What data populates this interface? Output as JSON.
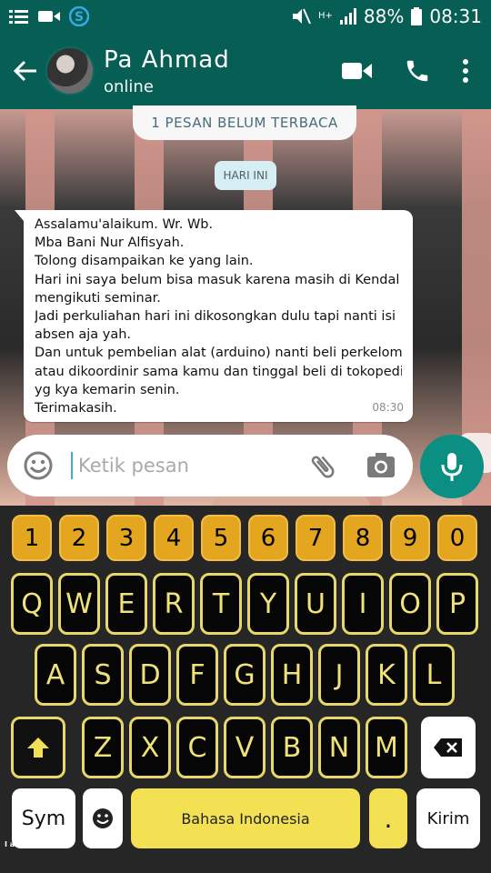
{
  "status_bar": {
    "battery_percent": "88%",
    "time": "08:31",
    "network": "H+",
    "icons": [
      "list-icon",
      "video-icon",
      "skype-icon",
      "mute-icon",
      "signal-icon",
      "battery-icon"
    ]
  },
  "header": {
    "contact_name": "Pa Ahmad",
    "status": "online",
    "icons": [
      "back-arrow-icon",
      "video-call-icon",
      "phone-icon",
      "more-vertical-icon"
    ]
  },
  "chat": {
    "unread_banner": "1 PESAN BELUM TERBACA",
    "date_label": "HARI INI",
    "message": {
      "lines": [
        "Assalamu'alaikum. Wr. Wb.",
        "Mba Bani Nur Alfisyah.",
        "Tolong disampaikan ke yang lain.",
        "Hari ini saya belum bisa masuk karena masih di Kendal lagi",
        "mengikuti seminar.",
        "Jadi perkuliahan hari ini dikosongkan dulu tapi nanti isi",
        "absen aja yah.",
        "Dan untuk pembelian alat (arduino) nanti beli perkelompok",
        "atau dikoordinir sama kamu dan tinggal beli di tokopedia",
        "yg kya kemarin senin.",
        "Terimakasih."
      ],
      "time": "08:30"
    }
  },
  "input": {
    "placeholder": "Ketik pesan",
    "icons": [
      "emoji-icon",
      "attach-icon",
      "camera-icon",
      "mic-icon"
    ]
  },
  "keyboard": {
    "number_row": [
      "1",
      "2",
      "3",
      "4",
      "5",
      "6",
      "7",
      "8",
      "9",
      "0"
    ],
    "row1": [
      "Q",
      "W",
      "E",
      "R",
      "T",
      "Y",
      "U",
      "I",
      "O",
      "P"
    ],
    "row2": [
      "A",
      "S",
      "D",
      "F",
      "G",
      "H",
      "J",
      "K",
      "L"
    ],
    "row3": [
      "Z",
      "X",
      "C",
      "V",
      "B",
      "N",
      "M"
    ],
    "sym_label": "Sym",
    "space_label": "Bahasa Indonesia",
    "period_label": ".",
    "send_label": "Kirim",
    "accent_colors": {
      "number_keys": "#e4a51f",
      "letter_text": "#f0e27b",
      "space_key": "#f3e153"
    }
  },
  "watermark": "I am Sorry !!!!!"
}
